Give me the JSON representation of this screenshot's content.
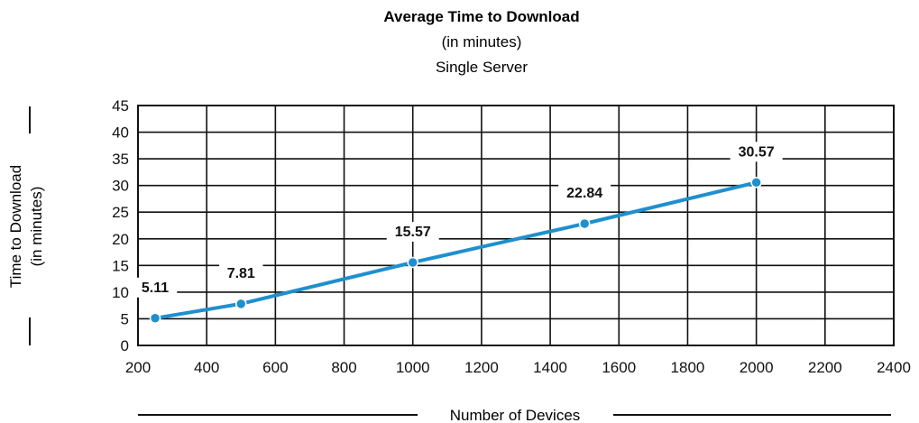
{
  "chart_data": {
    "type": "line",
    "title": "Average Time to Download",
    "subtitle_lines": [
      "(in minutes)",
      "Single Server"
    ],
    "xlabel": "Number of Devices",
    "ylabel_lines": [
      "Time to Download",
      "(in minutes)"
    ],
    "xlim": [
      200,
      2400
    ],
    "ylim": [
      0,
      45
    ],
    "x_ticks": [
      200,
      400,
      600,
      800,
      1000,
      1200,
      1400,
      1600,
      1800,
      2000,
      2200,
      2400
    ],
    "y_ticks": [
      0,
      5,
      10,
      15,
      20,
      25,
      30,
      35,
      40,
      45
    ],
    "grid": true,
    "series": [
      {
        "color": "#1f8fce",
        "points": [
          {
            "x": 250,
            "y": 5.11,
            "label": "5.11"
          },
          {
            "x": 500,
            "y": 7.81,
            "label": "7.81"
          },
          {
            "x": 1000,
            "y": 15.57,
            "label": "15.57"
          },
          {
            "x": 1500,
            "y": 22.84,
            "label": "22.84"
          },
          {
            "x": 2000,
            "y": 30.57,
            "label": "30.57"
          }
        ]
      }
    ]
  }
}
